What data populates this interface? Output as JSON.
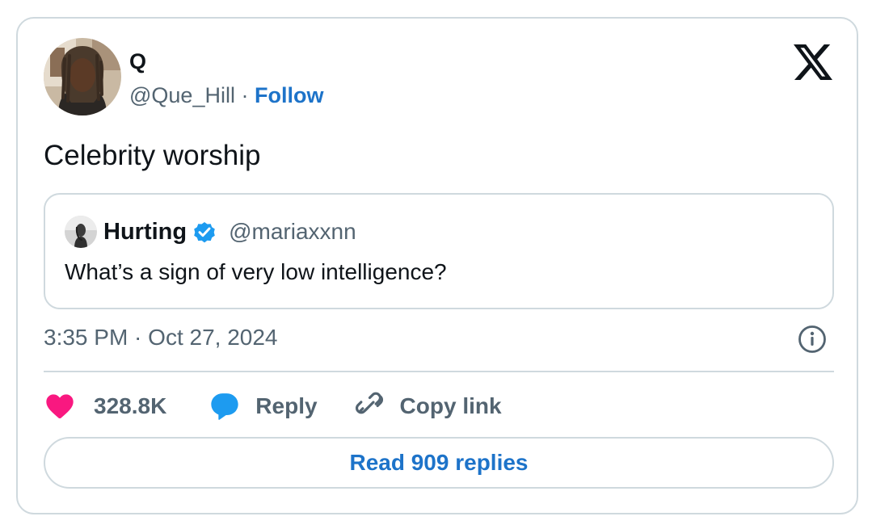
{
  "author": {
    "name": "Q",
    "handle": "@Que_Hill",
    "separator": "·",
    "follow_label": "Follow"
  },
  "tweet": {
    "text": "Celebrity worship",
    "timestamp": "3:35 PM · Oct 27, 2024"
  },
  "quoted": {
    "name": "Hurting",
    "handle": "@mariaxxnn",
    "text": "What’s a sign of very low intelligence?"
  },
  "actions": {
    "like_count": "328.8K",
    "reply_label": "Reply",
    "copy_label": "Copy link"
  },
  "read_replies_label": "Read 909 replies",
  "icons": {
    "logo": "x-logo-icon",
    "verified": "verified-badge-icon",
    "info": "info-icon",
    "like": "heart-icon",
    "reply": "speech-bubble-icon",
    "copy": "link-icon"
  },
  "colors": {
    "link_blue": "#1d73c9",
    "verified_blue": "#1d9bf0",
    "heart_pink": "#f91880",
    "muted_text": "#536471",
    "border": "#cfd9de"
  }
}
